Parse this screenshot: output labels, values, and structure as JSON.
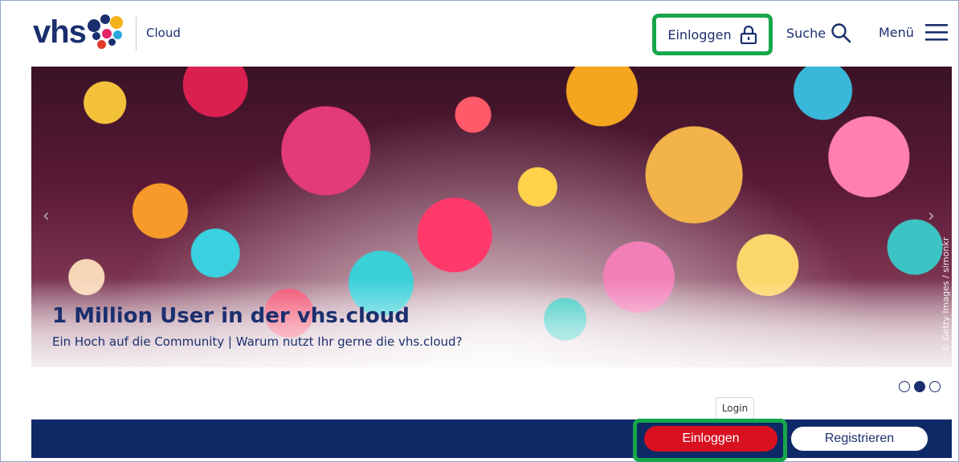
{
  "header": {
    "logo_text": "vhs",
    "logo_icon": "vhs-dots-logo",
    "brand_sub": "Cloud",
    "login_label": "Einloggen",
    "login_icon": "lock-icon",
    "search_label": "Suche",
    "search_icon": "search-icon",
    "menu_label": "Menü",
    "menu_icon": "hamburger-icon"
  },
  "hero": {
    "title": "1 Million User in der vhs.cloud",
    "subtitle": "Ein Hoch auf die Community | Warum nutzt Ihr gerne die vhs.cloud?",
    "credit": "© Getty Images / simonkr"
  },
  "carousel": {
    "slides": 3,
    "active_index": 1
  },
  "tooltip": {
    "text": "Login"
  },
  "actions": {
    "login_label": "Einloggen",
    "register_label": "Registrieren"
  },
  "colors": {
    "brand_navy": "#1b2f6e",
    "bar_navy": "#0d2a66",
    "login_red": "#d81020",
    "highlight_green": "#17a64a"
  }
}
